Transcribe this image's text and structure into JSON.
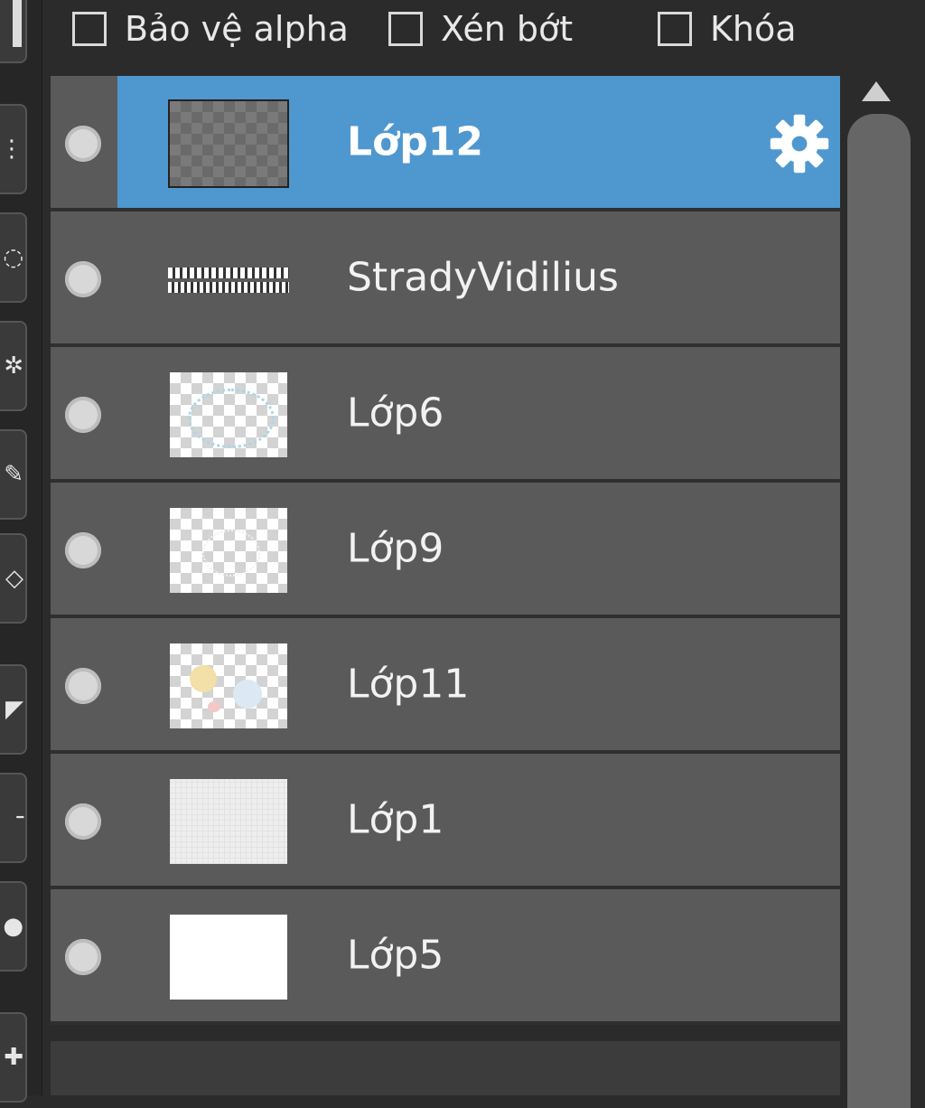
{
  "options": {
    "alpha_protect_label": "Bảo vệ alpha",
    "clip_label": "Xén bớt",
    "lock_label": "Khóa"
  },
  "layers": [
    {
      "name": "Lớp12",
      "selected": true
    },
    {
      "name": "StradyVidilius",
      "selected": false
    },
    {
      "name": "Lớp6",
      "selected": false
    },
    {
      "name": "Lớp9",
      "selected": false
    },
    {
      "name": "Lớp11",
      "selected": false
    },
    {
      "name": "Lớp1",
      "selected": false
    },
    {
      "name": "Lớp5",
      "selected": false
    }
  ],
  "colors": {
    "selected_row": "#4f97cf",
    "row": "#5a5a5a",
    "background": "#2b2b2b"
  }
}
